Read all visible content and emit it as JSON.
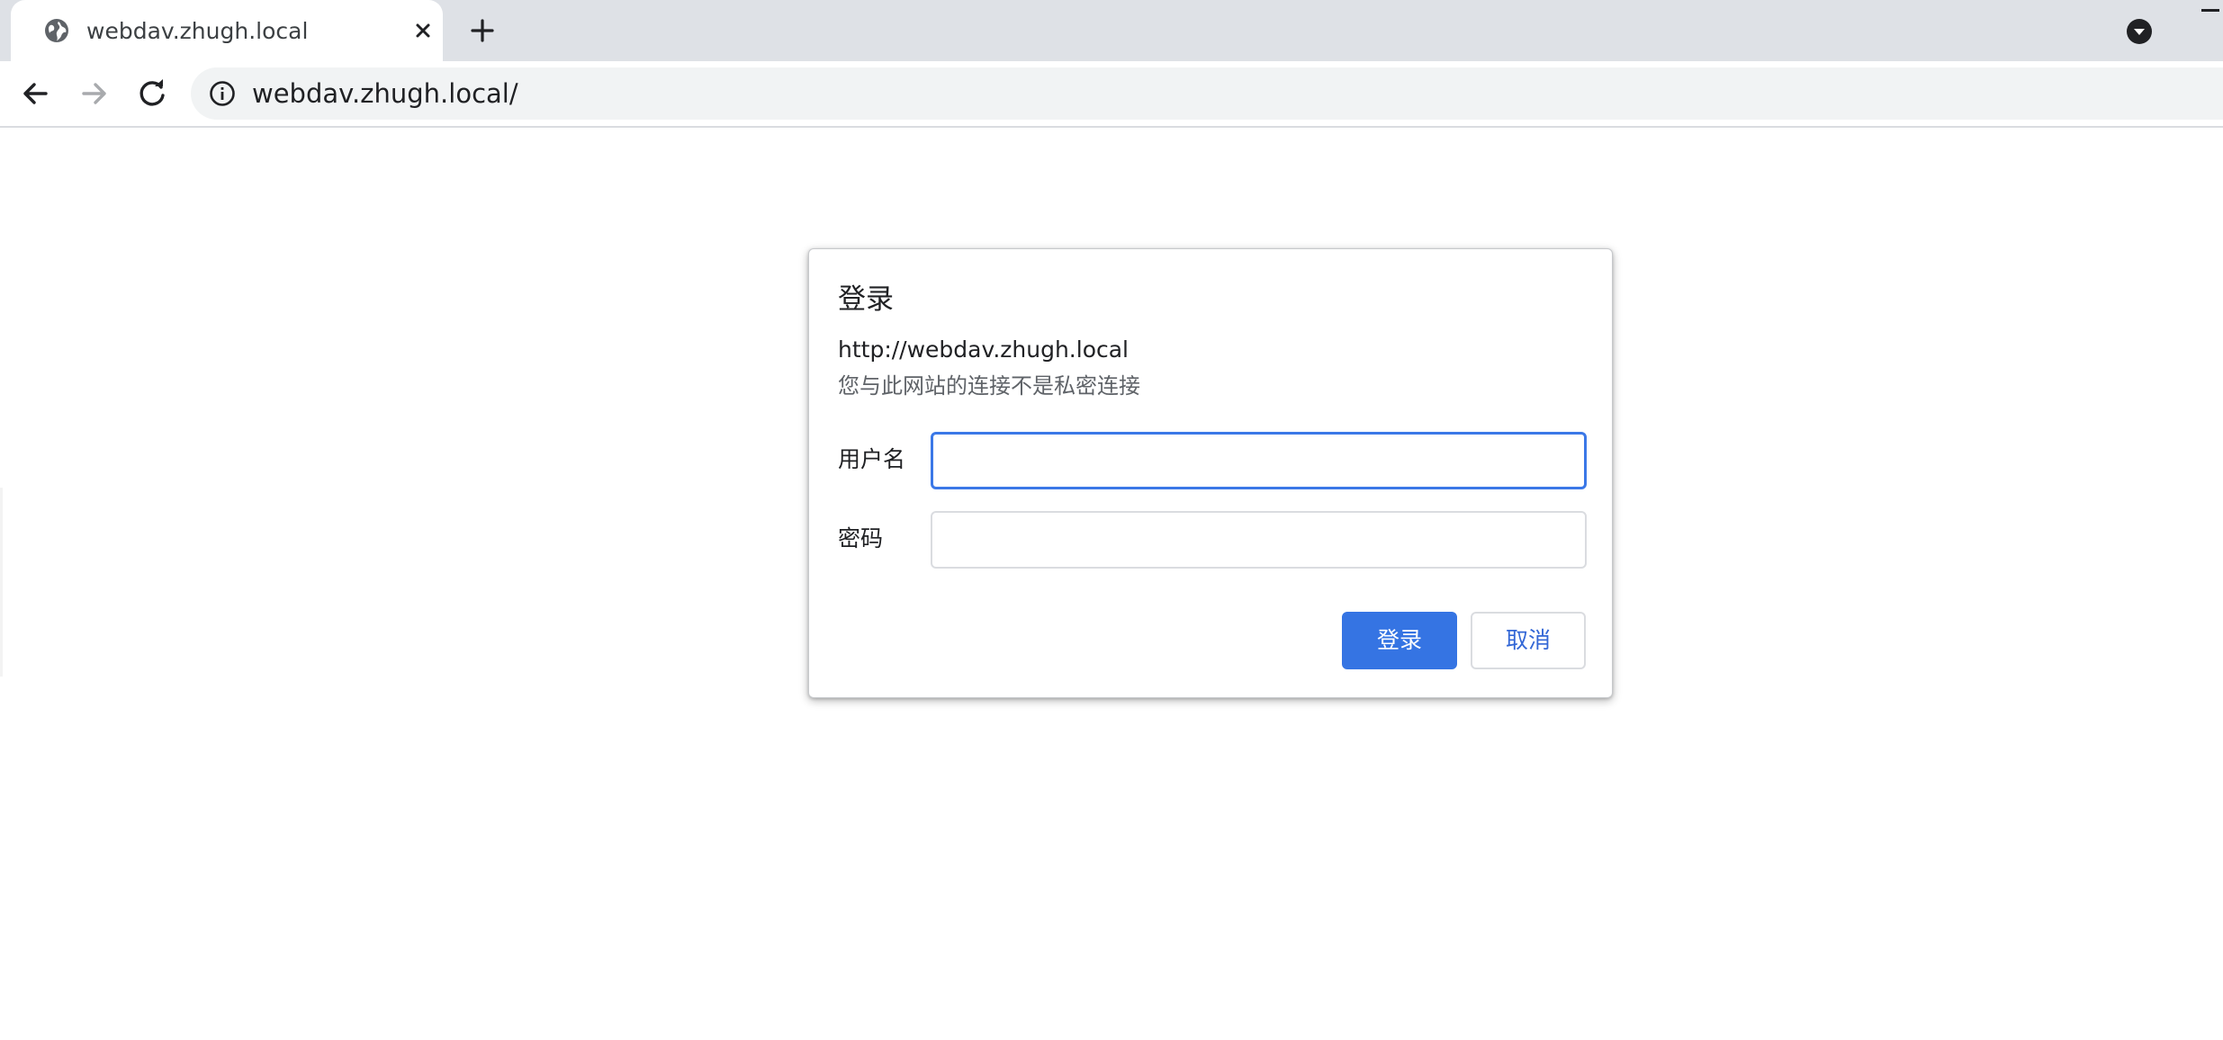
{
  "browser": {
    "tab": {
      "title": "webdav.zhugh.local",
      "favicon": "globe-icon",
      "close_icon": "close-icon"
    },
    "new_tab_icon": "plus-icon",
    "tab_search_icon": "chevron-down-circle-icon",
    "toolbar": {
      "back_icon": "arrow-left-icon",
      "forward_icon": "arrow-right-icon",
      "reload_icon": "reload-icon",
      "site_info_icon": "info-icon",
      "url": "webdav.zhugh.local/"
    }
  },
  "auth_dialog": {
    "title": "登录",
    "origin": "http://webdav.zhugh.local",
    "warning": "您与此网站的连接不是私密连接",
    "username_label": "用户名",
    "username_value": "",
    "password_label": "密码",
    "password_value": "",
    "signin_label": "登录",
    "cancel_label": "取消"
  },
  "colors": {
    "tabstrip_bg": "#dee1e6",
    "omnibox_bg": "#f1f3f4",
    "accent": "#3574e3",
    "focus_ring": "#3b78e7",
    "cancel_text": "#3367d6"
  }
}
